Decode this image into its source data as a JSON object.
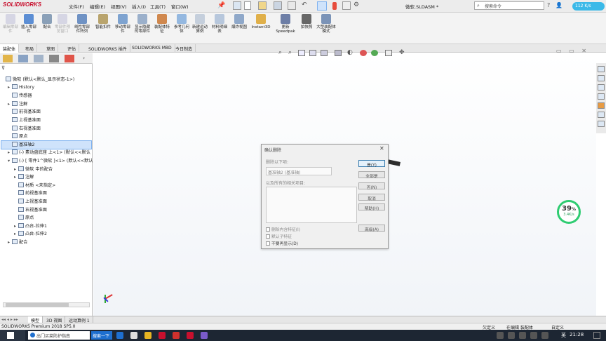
{
  "app": {
    "logo_text": "SOLIDWORKS",
    "doc_title": "微软.SLDASM *",
    "menus": [
      "文件(F)",
      "编辑(E)",
      "视图(V)",
      "插入(I)",
      "工具(T)",
      "窗口(W)"
    ],
    "search_placeholder": "搜索命令",
    "net_speed": "112 K/s"
  },
  "ribbon": {
    "buttons": [
      {
        "label": "编辑零部件",
        "dim": true
      },
      {
        "label": "插入零部件",
        "dim": false
      },
      {
        "label": "配合",
        "dim": false
      },
      {
        "label": "零部件预览窗口",
        "dim": true
      },
      {
        "label": "线性零部件阵列",
        "dim": false
      },
      {
        "label": "智能扣件",
        "dim": false
      },
      {
        "label": "移动零部件",
        "dim": false
      },
      {
        "label": "显示隐藏的零部件",
        "dim": false
      },
      {
        "label": "装配体特征",
        "dim": false
      },
      {
        "label": "参考几何体",
        "dim": false
      },
      {
        "label": "新建运动算例",
        "dim": false
      },
      {
        "label": "材料明细表",
        "dim": false
      },
      {
        "label": "爆炸视图",
        "dim": false
      },
      {
        "label": "Instant3D",
        "dim": false
      },
      {
        "label": "更新Speedpak",
        "dim": false
      },
      {
        "label": "拍快照",
        "dim": false
      },
      {
        "label": "大型装配体模式",
        "dim": false
      }
    ]
  },
  "tabs": [
    "装配体",
    "布局",
    "草图",
    "评估",
    "SOLIDWORKS 插件",
    "SOLIDWORKS MBD",
    "今日制造"
  ],
  "tree": [
    {
      "label": "微软 (默认<默认_显示状态-1>)",
      "indent": 0,
      "toggle": ""
    },
    {
      "label": "History",
      "indent": 1,
      "toggle": "▸"
    },
    {
      "label": "传感器",
      "indent": 1,
      "toggle": ""
    },
    {
      "label": "注解",
      "indent": 1,
      "toggle": "▸"
    },
    {
      "label": "前视基准面",
      "indent": 1,
      "toggle": ""
    },
    {
      "label": "上视基准面",
      "indent": 1,
      "toggle": ""
    },
    {
      "label": "右视基准面",
      "indent": 1,
      "toggle": ""
    },
    {
      "label": "原点",
      "indent": 1,
      "toggle": ""
    },
    {
      "label": "基准轴2",
      "indent": 1,
      "toggle": "",
      "selected": true
    },
    {
      "label": "(-) 素动盘底座 上<1> (默认<<默认",
      "indent": 1,
      "toggle": "▸"
    },
    {
      "label": "(-) [ 零件1^微软 ]<1> (默认<<默认",
      "indent": 1,
      "toggle": "▾"
    },
    {
      "label": "微软 中的配合",
      "indent": 2,
      "toggle": "▸"
    },
    {
      "label": "注解",
      "indent": 2,
      "toggle": "▸"
    },
    {
      "label": "材质 <未指定>",
      "indent": 2,
      "toggle": ""
    },
    {
      "label": "前视基准面",
      "indent": 2,
      "toggle": ""
    },
    {
      "label": "上视基准面",
      "indent": 2,
      "toggle": ""
    },
    {
      "label": "右视基准面",
      "indent": 2,
      "toggle": ""
    },
    {
      "label": "原点",
      "indent": 2,
      "toggle": ""
    },
    {
      "label": "凸台-拉伸1",
      "indent": 2,
      "toggle": "▸"
    },
    {
      "label": "凸台-拉伸2",
      "indent": 2,
      "toggle": "▸"
    },
    {
      "label": "配合",
      "indent": 1,
      "toggle": "▸"
    }
  ],
  "dialog": {
    "title": "确认删除",
    "delete_label": "删除以下项:",
    "delete_item": "基准轴2 (基准轴)",
    "related_label": "以及所有的相关项目:",
    "buttons": [
      "是(Y)",
      "全部是",
      "否(N)",
      "取消",
      "帮助(H)",
      "高级(A)"
    ],
    "checks": [
      "删除内含特征(I)",
      "默认子特征",
      "不要再显示(D)"
    ]
  },
  "bottom_tabs": [
    "模型",
    "3D 视图",
    "运动算例 1"
  ],
  "status": {
    "left": "SOLIDWORKS Premium 2018 SP5.0",
    "mid1": "欠定义",
    "mid2": "在编辑 装配体",
    "right": "自定义"
  },
  "taskbar": {
    "search_text": "出门买菜防护指南",
    "search_btn": "搜索一下",
    "lang": "英",
    "time": "21:28"
  },
  "speed_widget": {
    "percent": "39",
    "unit": "%",
    "sub": "3.4K/s"
  },
  "colors": {
    "accent": "#c8102e",
    "select": "#cfe3fb",
    "taskbar": "#1d2633"
  }
}
